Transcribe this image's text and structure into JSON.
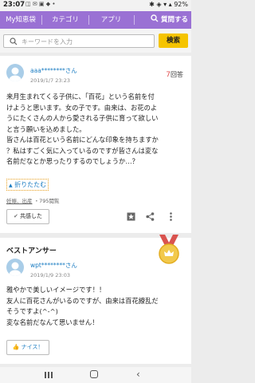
{
  "status_bar": {
    "time": "23:07",
    "left_icons": "◫ ✉ ▣ ◆ •",
    "right": "✱ ◈ ▾ ▴ 92%",
    "battery_pct": 92
  },
  "nav": {
    "tabs": [
      "My知恵袋",
      "カテゴリ",
      "アプリ"
    ],
    "ask_label": "質問する"
  },
  "search": {
    "placeholder": "キーワードを入力",
    "button_label": "検索"
  },
  "question": {
    "user": "aaa********さん",
    "date": "2019/1/7 23:23",
    "answer_count_num": "7",
    "answer_count_unit": "回答",
    "lines": [
      "来月生まれてくる子供に、「百花」という名前を付",
      "けようと思います。女の子です。由来は、お花のよ",
      "うにたくさんの人から愛される子供に育って欲しい",
      "と言う願いを込めました。",
      "皆さんは百花という名前にどんな印象を持ちますか",
      "？私はすごく気に入っているのですが皆さんは変な",
      "名前だなとか思ったりするのでしょうか…？"
    ],
    "collapse_label": "折りたたむ",
    "category": "妊娠、出産",
    "views": "795閲覧",
    "share_label": "共感した"
  },
  "best_answer": {
    "heading": "ベストアンサー",
    "user": "wpt********さん",
    "date": "2019/1/9 23:03",
    "lines": [
      "雅やかで美しいイメージです！！",
      "友人に百花さんがいるのですが、由来は百花繚乱だ",
      "そうですよ(^-^)",
      "変な名前だなんて思いません！"
    ],
    "like_label": "ナイス！"
  },
  "colors": {
    "nav": "#9a71d4",
    "search_button": "#f5c400",
    "accent_red": "#e05050",
    "link_blue": "#1a7cc2"
  }
}
